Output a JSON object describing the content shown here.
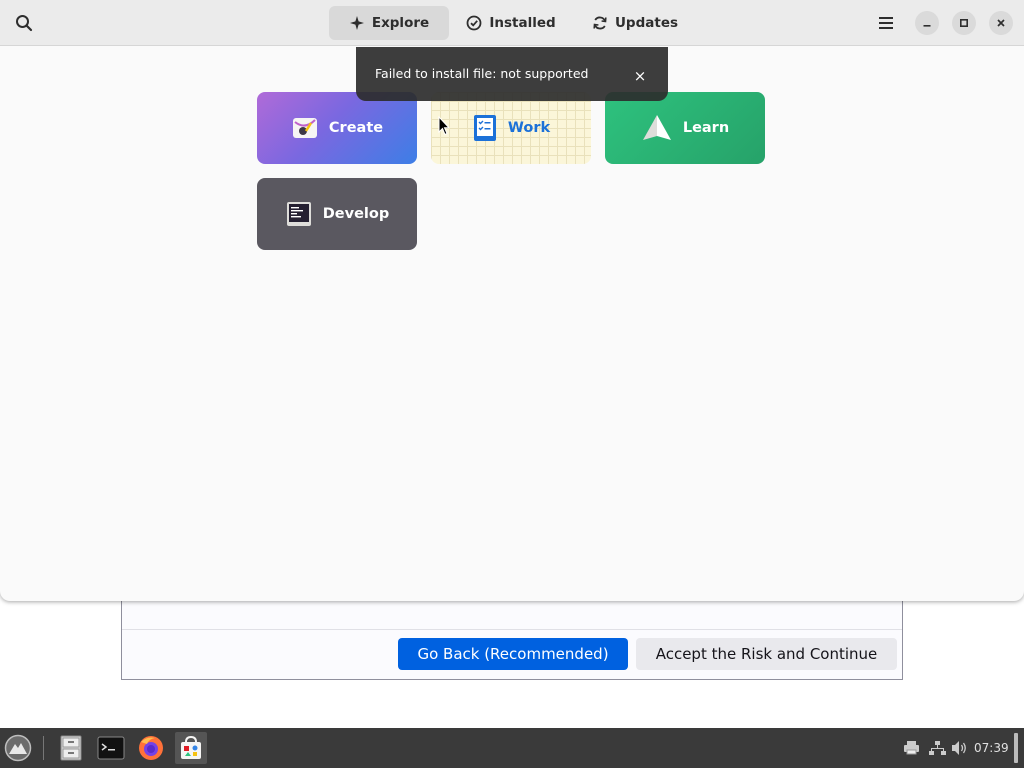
{
  "dialog": {
    "go_back_label": "Go Back (Recommended)",
    "accept_label": "Accept the Risk and Continue"
  },
  "headerbar": {
    "tabs": [
      {
        "label": "Explore",
        "icon": "sparkle-icon",
        "active": true
      },
      {
        "label": "Installed",
        "icon": "check-circle-icon",
        "active": false
      },
      {
        "label": "Updates",
        "icon": "refresh-icon",
        "active": false
      }
    ]
  },
  "toast": {
    "message": "Failed to install file: not supported",
    "close_glyph": "×"
  },
  "categories": [
    {
      "label": "Create",
      "icon": "palette-icon"
    },
    {
      "label": "Work",
      "icon": "checklist-icon"
    },
    {
      "label": "Learn",
      "icon": "paper-plane-icon"
    },
    {
      "label": "Develop",
      "icon": "code-terminal-icon"
    }
  ],
  "taskbar": {
    "clock": "07:39",
    "apps": [
      "start-menu",
      "file-manager",
      "terminal",
      "firefox",
      "software-center"
    ]
  },
  "colors": {
    "accent_blue": "#0061e0",
    "create_gradient_start": "#b06ad8",
    "learn_green": "#2ec27e",
    "develop_gray": "#5a5860"
  }
}
